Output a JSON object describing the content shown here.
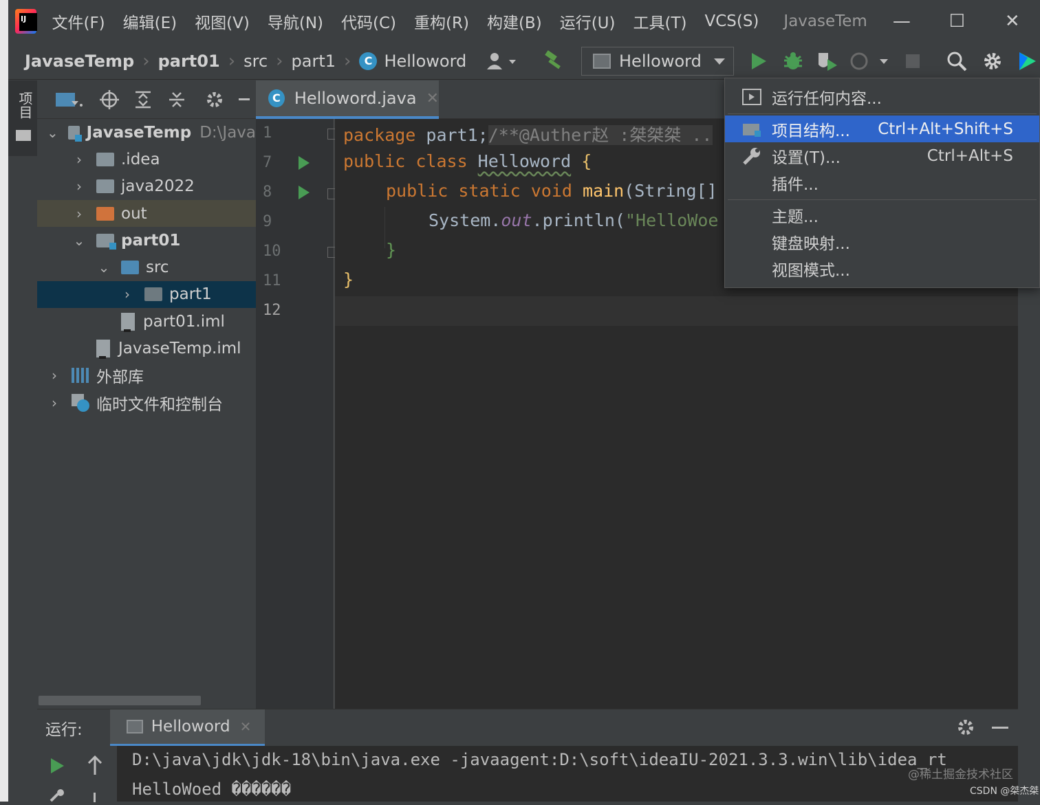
{
  "menubar": {
    "items": [
      "文件(F)",
      "编辑(E)",
      "视图(V)",
      "导航(N)",
      "代码(C)",
      "重构(R)",
      "构建(B)",
      "运行(U)",
      "工具(T)",
      "VCS(S)"
    ],
    "window_title": "JavaseTem",
    "minimize": "—",
    "maximize": "☐",
    "close": "✕"
  },
  "navbar": {
    "breadcrumbs": [
      "JavaseTemp",
      "part01",
      "src",
      "part1",
      "Helloword"
    ],
    "run_config": "Helloword",
    "accent_run": "#499c54",
    "accent_debug": "#3592c4"
  },
  "left_stripe": {
    "label": "项目"
  },
  "project": {
    "tree": [
      {
        "label": "JavaseTemp",
        "hint": "D:\\Java",
        "expanded": true
      },
      {
        "label": ".idea"
      },
      {
        "label": "java2022"
      },
      {
        "label": "out"
      },
      {
        "label": "part01",
        "expanded": true
      },
      {
        "label": "src",
        "expanded": true
      },
      {
        "label": "part1",
        "selected": true
      },
      {
        "label": "part01.iml"
      },
      {
        "label": "JavaseTemp.iml"
      },
      {
        "label": "外部库"
      },
      {
        "label": "临时文件和控制台"
      }
    ]
  },
  "editor": {
    "tab_label": "Helloword.java",
    "line_numbers": [
      "1",
      "7",
      "8",
      "9",
      "10",
      "11",
      "12"
    ],
    "code": {
      "l1_kw": "package",
      "l1_rest": " part1;",
      "l1_comment": "/**@Auther赵 :桀桀桀 ..",
      "l7_kw": "public class ",
      "l7_cls": "Helloword",
      "l7_rest": " {",
      "l8_kw": "public static void ",
      "l8_fn": "main",
      "l8_rest": "(String[]",
      "l9_a": "System.",
      "l9_field": "out",
      "l9_b": ".println(",
      "l9_str": "\"HelloWoe",
      "l10": "}",
      "l11": "}"
    }
  },
  "dropdown": {
    "items": [
      {
        "label": "运行任何内容...",
        "shortcut": "",
        "icon": "run-anything-icon"
      },
      {
        "label": "项目结构...",
        "shortcut": "Ctrl+Alt+Shift+S",
        "icon": "project-structure-icon",
        "active": true
      },
      {
        "label": "设置(T)...",
        "shortcut": "Ctrl+Alt+S",
        "icon": "wrench-icon"
      },
      {
        "label": "插件...",
        "shortcut": ""
      },
      {
        "label": "主题...",
        "shortcut": ""
      },
      {
        "label": "键盘映射...",
        "shortcut": ""
      },
      {
        "label": "视图模式...",
        "shortcut": ""
      }
    ]
  },
  "run_panel": {
    "title": "运行:",
    "tab_label": "Helloword",
    "console_lines": [
      "D:\\java\\jdk\\jdk-18\\bin\\java.exe -javaagent:D:\\soft\\ideaIU-2021.3.3.win\\lib\\idea_rt",
      "HelloWoed ������"
    ]
  },
  "watermark": {
    "text": "@稀土掘金技术社区",
    "credit": "CSDN @桀杰桀"
  }
}
